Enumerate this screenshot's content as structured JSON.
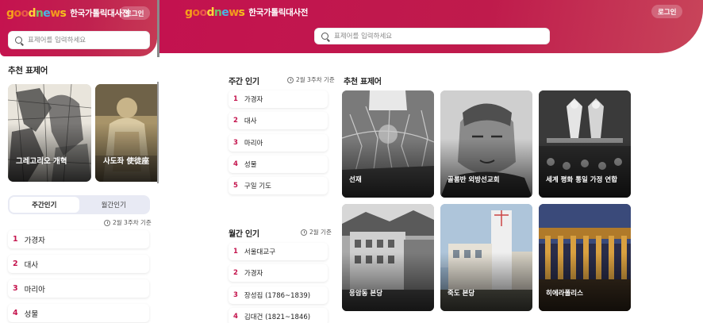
{
  "app": {
    "logo_wordmark": "goodnews",
    "title": "한국가톨릭대사전",
    "login_label": "로그인",
    "search_placeholder": "표제어를 입력하세요",
    "brand_color": "#c3124f",
    "rank_color": "#c4144d"
  },
  "left": {
    "recommended_title": "추천 표제어",
    "cards": [
      {
        "label": "그레고리오 개혁"
      },
      {
        "label": "사도좌 使徒座"
      }
    ],
    "tabs": [
      {
        "label": "주간인기",
        "active": true
      },
      {
        "label": "월간인기",
        "active": false
      }
    ],
    "basis": "2월 3주차 기준",
    "items": [
      {
        "rank": "1",
        "text": "가경자"
      },
      {
        "rank": "2",
        "text": "대사"
      },
      {
        "rank": "3",
        "text": "마리아"
      },
      {
        "rank": "4",
        "text": "성물"
      }
    ]
  },
  "weekly": {
    "title": "주간 인기",
    "basis": "2월 3주차 기준",
    "items": [
      {
        "rank": "1",
        "text": "가경자"
      },
      {
        "rank": "2",
        "text": "대사"
      },
      {
        "rank": "3",
        "text": "마리아"
      },
      {
        "rank": "4",
        "text": "성물"
      },
      {
        "rank": "5",
        "text": "구일 기도"
      }
    ]
  },
  "monthly": {
    "title": "월간 인기",
    "basis": "2월 기준",
    "items": [
      {
        "rank": "1",
        "text": "서울대교구"
      },
      {
        "rank": "2",
        "text": "가경자"
      },
      {
        "rank": "3",
        "text": "장성집 (1786~1839)"
      },
      {
        "rank": "4",
        "text": "김대건 (1821~1846)"
      }
    ]
  },
  "recommended": {
    "title": "추천 표제어",
    "cards": [
      {
        "label": "선재"
      },
      {
        "label": "골롬반 외방선교회"
      },
      {
        "label": "세계 평화 통일 가정 연합"
      },
      {
        "label": "응암동 본당"
      },
      {
        "label": "죽도 본당"
      },
      {
        "label": "히에라폴리스"
      }
    ]
  }
}
